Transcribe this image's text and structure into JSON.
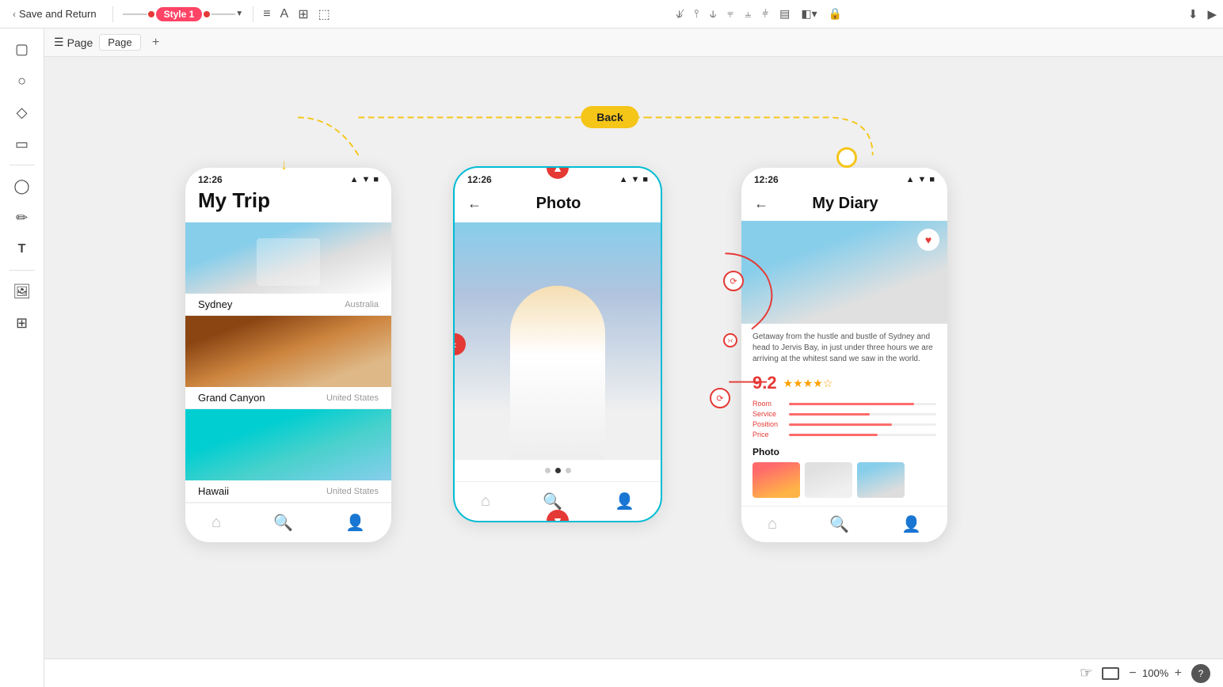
{
  "toolbar": {
    "save_return": "Save and Return",
    "style_label": "Style 1",
    "page_label": "Page",
    "add_label": "+"
  },
  "phones": {
    "phone1": {
      "time": "12:26",
      "title": "My Trip",
      "items": [
        {
          "name": "Sydney",
          "country": "Australia"
        },
        {
          "name": "Grand Canyon",
          "country": "United States"
        },
        {
          "name": "Hawaii",
          "country": "United States"
        }
      ]
    },
    "phone2": {
      "time": "12:26",
      "title": "Photo",
      "dots": 3,
      "active_dot": 1
    },
    "phone3": {
      "time": "12:26",
      "title": "My Diary",
      "description": "Getaway from the hustle and bustle of Sydney and head to Jervis Bay, in just under three hours we are arriving at the whitest sand we saw in the world.",
      "rating": "9.2",
      "stars": "★★★★☆",
      "bars": [
        {
          "label": "Room",
          "pct": 85
        },
        {
          "label": "Service",
          "pct": 55
        },
        {
          "label": "Position",
          "pct": 70
        },
        {
          "label": "Price",
          "pct": 60
        }
      ],
      "photos_label": "Photo"
    }
  },
  "canvas": {
    "back_label": "Back",
    "zoom_pct": "100%"
  },
  "bottom": {
    "zoom_minus": "−",
    "zoom_plus": "+",
    "zoom_pct": "100%",
    "help": "?"
  }
}
